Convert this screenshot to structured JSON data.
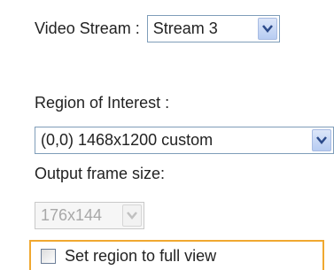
{
  "video_stream": {
    "label": "Video Stream :",
    "selected": "Stream 3"
  },
  "roi": {
    "label": "Region of Interest :",
    "selected": "(0,0) 1468x1200 custom"
  },
  "output_frame": {
    "label": "Output frame size:",
    "selected": "176x144",
    "disabled": true
  },
  "full_view": {
    "label": "Set region to full view",
    "checked": false
  },
  "colors": {
    "highlight_border": "#f0a830",
    "dropdown_arrow": "#2b4a8a"
  },
  "icons": [
    "chevron-down-icon",
    "checkbox-unchecked"
  ]
}
